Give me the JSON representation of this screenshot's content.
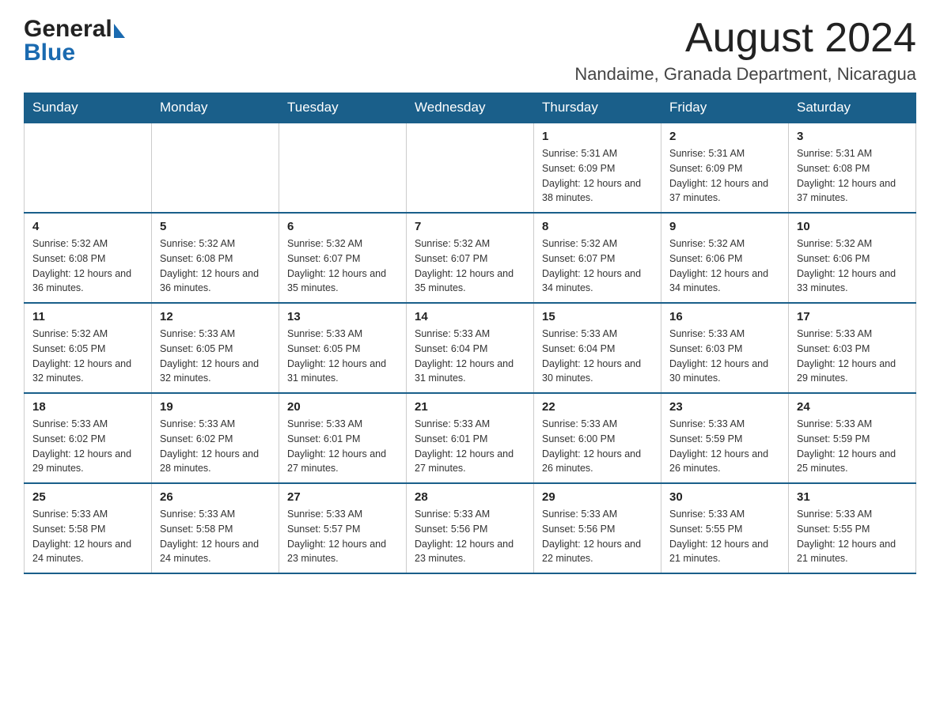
{
  "header": {
    "logo_general": "General",
    "logo_blue": "Blue",
    "month_year": "August 2024",
    "location": "Nandaime, Granada Department, Nicaragua"
  },
  "days_of_week": [
    "Sunday",
    "Monday",
    "Tuesday",
    "Wednesday",
    "Thursday",
    "Friday",
    "Saturday"
  ],
  "weeks": [
    {
      "days": [
        {
          "num": "",
          "info": ""
        },
        {
          "num": "",
          "info": ""
        },
        {
          "num": "",
          "info": ""
        },
        {
          "num": "",
          "info": ""
        },
        {
          "num": "1",
          "info": "Sunrise: 5:31 AM\nSunset: 6:09 PM\nDaylight: 12 hours and 38 minutes."
        },
        {
          "num": "2",
          "info": "Sunrise: 5:31 AM\nSunset: 6:09 PM\nDaylight: 12 hours and 37 minutes."
        },
        {
          "num": "3",
          "info": "Sunrise: 5:31 AM\nSunset: 6:08 PM\nDaylight: 12 hours and 37 minutes."
        }
      ]
    },
    {
      "days": [
        {
          "num": "4",
          "info": "Sunrise: 5:32 AM\nSunset: 6:08 PM\nDaylight: 12 hours and 36 minutes."
        },
        {
          "num": "5",
          "info": "Sunrise: 5:32 AM\nSunset: 6:08 PM\nDaylight: 12 hours and 36 minutes."
        },
        {
          "num": "6",
          "info": "Sunrise: 5:32 AM\nSunset: 6:07 PM\nDaylight: 12 hours and 35 minutes."
        },
        {
          "num": "7",
          "info": "Sunrise: 5:32 AM\nSunset: 6:07 PM\nDaylight: 12 hours and 35 minutes."
        },
        {
          "num": "8",
          "info": "Sunrise: 5:32 AM\nSunset: 6:07 PM\nDaylight: 12 hours and 34 minutes."
        },
        {
          "num": "9",
          "info": "Sunrise: 5:32 AM\nSunset: 6:06 PM\nDaylight: 12 hours and 34 minutes."
        },
        {
          "num": "10",
          "info": "Sunrise: 5:32 AM\nSunset: 6:06 PM\nDaylight: 12 hours and 33 minutes."
        }
      ]
    },
    {
      "days": [
        {
          "num": "11",
          "info": "Sunrise: 5:32 AM\nSunset: 6:05 PM\nDaylight: 12 hours and 32 minutes."
        },
        {
          "num": "12",
          "info": "Sunrise: 5:33 AM\nSunset: 6:05 PM\nDaylight: 12 hours and 32 minutes."
        },
        {
          "num": "13",
          "info": "Sunrise: 5:33 AM\nSunset: 6:05 PM\nDaylight: 12 hours and 31 minutes."
        },
        {
          "num": "14",
          "info": "Sunrise: 5:33 AM\nSunset: 6:04 PM\nDaylight: 12 hours and 31 minutes."
        },
        {
          "num": "15",
          "info": "Sunrise: 5:33 AM\nSunset: 6:04 PM\nDaylight: 12 hours and 30 minutes."
        },
        {
          "num": "16",
          "info": "Sunrise: 5:33 AM\nSunset: 6:03 PM\nDaylight: 12 hours and 30 minutes."
        },
        {
          "num": "17",
          "info": "Sunrise: 5:33 AM\nSunset: 6:03 PM\nDaylight: 12 hours and 29 minutes."
        }
      ]
    },
    {
      "days": [
        {
          "num": "18",
          "info": "Sunrise: 5:33 AM\nSunset: 6:02 PM\nDaylight: 12 hours and 29 minutes."
        },
        {
          "num": "19",
          "info": "Sunrise: 5:33 AM\nSunset: 6:02 PM\nDaylight: 12 hours and 28 minutes."
        },
        {
          "num": "20",
          "info": "Sunrise: 5:33 AM\nSunset: 6:01 PM\nDaylight: 12 hours and 27 minutes."
        },
        {
          "num": "21",
          "info": "Sunrise: 5:33 AM\nSunset: 6:01 PM\nDaylight: 12 hours and 27 minutes."
        },
        {
          "num": "22",
          "info": "Sunrise: 5:33 AM\nSunset: 6:00 PM\nDaylight: 12 hours and 26 minutes."
        },
        {
          "num": "23",
          "info": "Sunrise: 5:33 AM\nSunset: 5:59 PM\nDaylight: 12 hours and 26 minutes."
        },
        {
          "num": "24",
          "info": "Sunrise: 5:33 AM\nSunset: 5:59 PM\nDaylight: 12 hours and 25 minutes."
        }
      ]
    },
    {
      "days": [
        {
          "num": "25",
          "info": "Sunrise: 5:33 AM\nSunset: 5:58 PM\nDaylight: 12 hours and 24 minutes."
        },
        {
          "num": "26",
          "info": "Sunrise: 5:33 AM\nSunset: 5:58 PM\nDaylight: 12 hours and 24 minutes."
        },
        {
          "num": "27",
          "info": "Sunrise: 5:33 AM\nSunset: 5:57 PM\nDaylight: 12 hours and 23 minutes."
        },
        {
          "num": "28",
          "info": "Sunrise: 5:33 AM\nSunset: 5:56 PM\nDaylight: 12 hours and 23 minutes."
        },
        {
          "num": "29",
          "info": "Sunrise: 5:33 AM\nSunset: 5:56 PM\nDaylight: 12 hours and 22 minutes."
        },
        {
          "num": "30",
          "info": "Sunrise: 5:33 AM\nSunset: 5:55 PM\nDaylight: 12 hours and 21 minutes."
        },
        {
          "num": "31",
          "info": "Sunrise: 5:33 AM\nSunset: 5:55 PM\nDaylight: 12 hours and 21 minutes."
        }
      ]
    }
  ]
}
